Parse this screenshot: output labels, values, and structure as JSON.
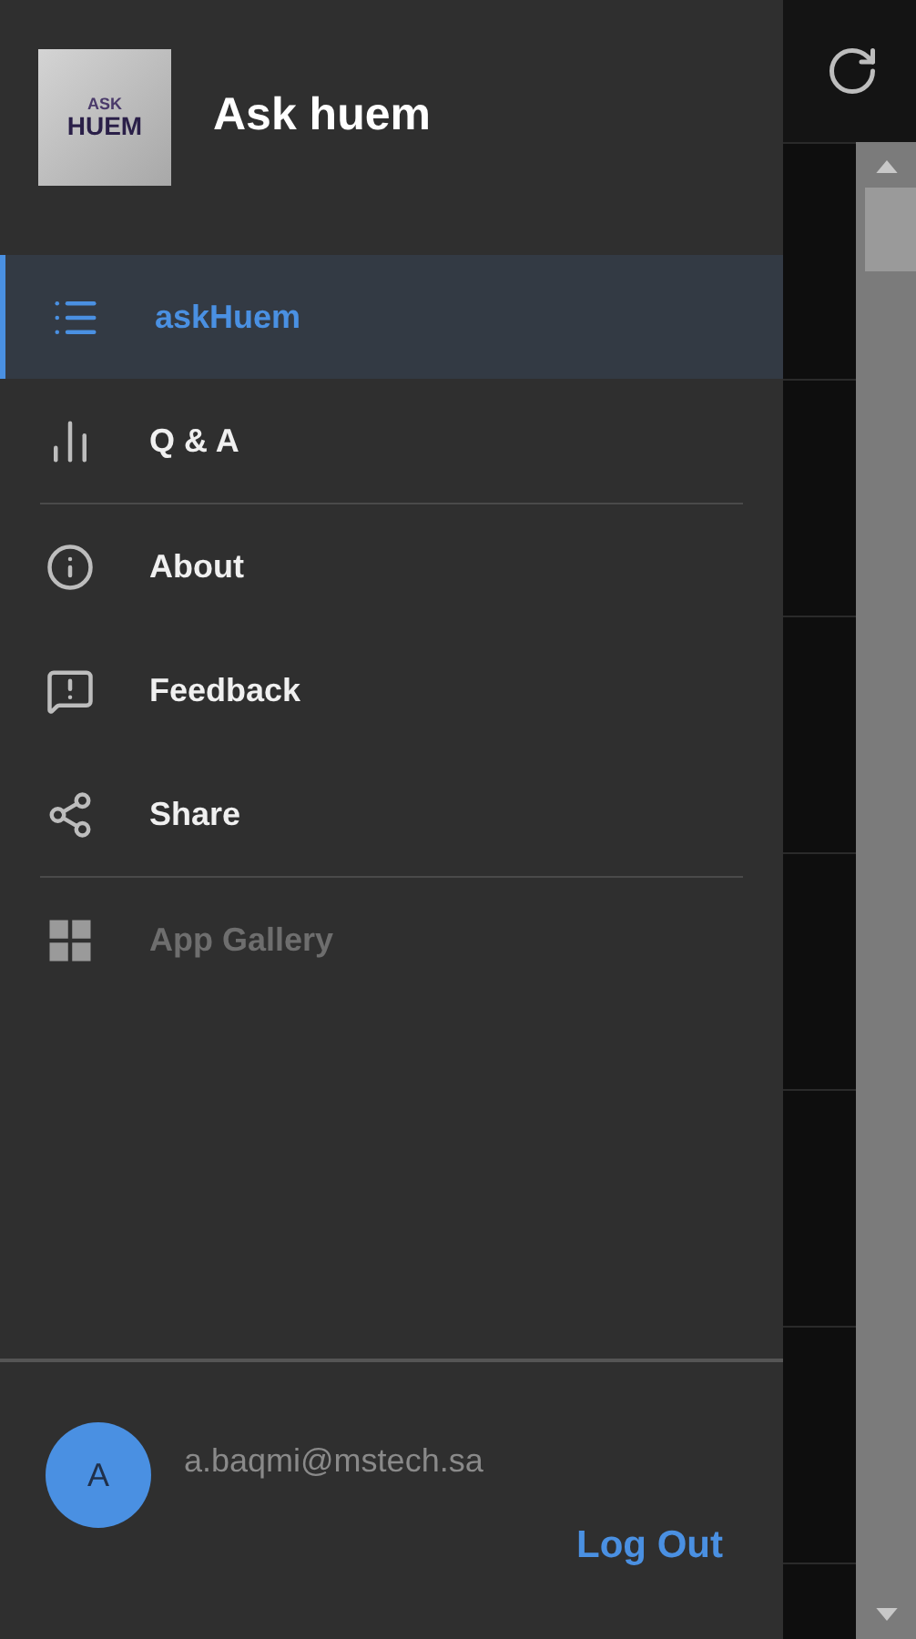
{
  "drawer": {
    "logo": {
      "line1": "ASK",
      "line2": "HUEM"
    },
    "title": "Ask huem",
    "menu_groups": [
      [
        {
          "kind": "list",
          "label": "askHuem",
          "selected": true,
          "disabled": false
        },
        {
          "kind": "chart",
          "label": "Q & A",
          "selected": false,
          "disabled": false
        }
      ],
      [
        {
          "kind": "info",
          "label": "About",
          "selected": false,
          "disabled": false
        },
        {
          "kind": "feedback",
          "label": "Feedback",
          "selected": false,
          "disabled": false
        },
        {
          "kind": "share",
          "label": "Share",
          "selected": false,
          "disabled": false
        }
      ],
      [
        {
          "kind": "grid",
          "label": "App Gallery",
          "selected": false,
          "disabled": true
        }
      ]
    ],
    "account": {
      "avatar_letter": "A",
      "email": "a.baqmi@mstech.sa"
    },
    "logout": "Log Out"
  }
}
